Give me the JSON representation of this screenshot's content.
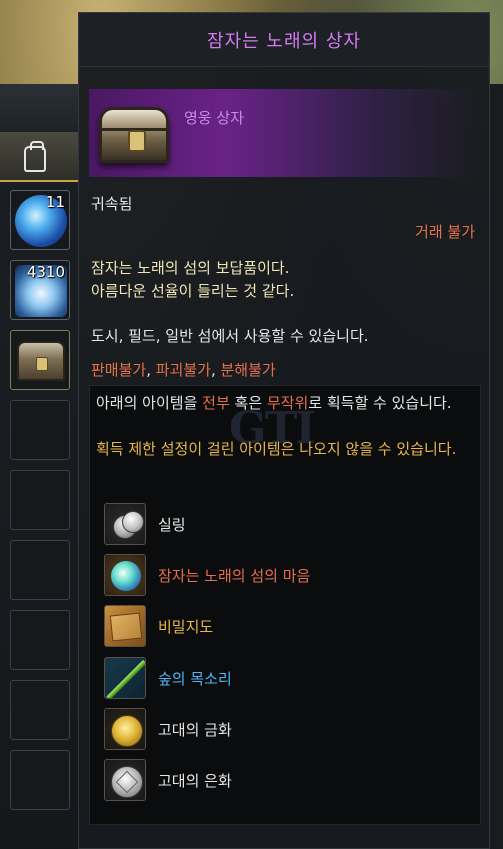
{
  "inventory": {
    "slots": [
      {
        "count": "11",
        "icon": "blue-gem"
      },
      {
        "count": "4310",
        "icon": "crystal-gem"
      },
      {
        "count": "",
        "icon": "treasure-chest"
      }
    ]
  },
  "tooltip": {
    "title": "잠자는 노래의 상자",
    "grade": "영웅 상자",
    "bound": "귀속됨",
    "trade": "거래 불가",
    "description": [
      "잠자는 노래의 섬의 보답품이다.",
      "아름다운 선율이 들리는 것 같다."
    ],
    "usage": "도시, 필드, 일반 섬에서 사용할 수 있습니다.",
    "flags": [
      "판매불가",
      "파괴불가",
      "분해불가"
    ],
    "flag_separator": ", ",
    "acquire": {
      "prefix": "아래의 아이템을 ",
      "all": "전부",
      "or": " 혹은 ",
      "random": "무작위",
      "suffix": "로 획득할 수 있습니다."
    },
    "restriction_note": "획득 제한 설정이 걸린 아이템은 나오지 않을 수 있습니다.",
    "rewards": [
      {
        "name": "실링",
        "icon": "silver-coins-icon",
        "color": "#e6e6e6"
      },
      {
        "name": "잠자는 노래의 섬의 마음",
        "icon": "island-heart-icon",
        "color": "#e4704c"
      },
      {
        "name": "비밀지도",
        "icon": "secret-map-icon",
        "color": "#e8b84a"
      },
      {
        "name": "숲의 목소리",
        "icon": "flute-icon",
        "color": "#4fb6f0"
      },
      {
        "name": "고대의 금화",
        "icon": "gold-coin-icon",
        "color": "#e6e6e6"
      },
      {
        "name": "고대의 은화",
        "icon": "silver-coin-icon",
        "color": "#e6e6e6"
      }
    ]
  },
  "watermark": "GTI",
  "colors": {
    "title": "#d37cf0",
    "grade": "#c98ae8",
    "warning": "#e4704c",
    "description": "#f0e6b8",
    "note": "#e8b84a"
  }
}
